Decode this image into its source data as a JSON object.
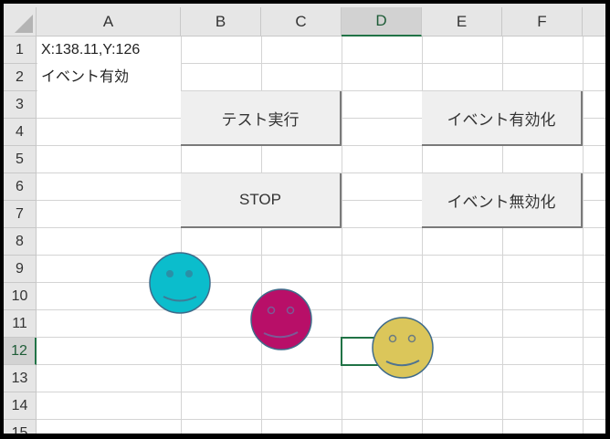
{
  "columns": [
    "A",
    "B",
    "C",
    "D",
    "E",
    "F"
  ],
  "rows": [
    "1",
    "2",
    "3",
    "4",
    "5",
    "6",
    "7",
    "8",
    "9",
    "10",
    "11",
    "12",
    "13",
    "14",
    "15"
  ],
  "selected_cell": "D12",
  "cells": {
    "A1": "X:138.11,Y:126",
    "A2": "イベント有効"
  },
  "buttons": {
    "test_run": "テスト実行",
    "stop": "STOP",
    "enable_events": "イベント有効化",
    "disable_events": "イベント無効化"
  },
  "shapes": [
    {
      "type": "smiley",
      "fill": "#0bbdcc"
    },
    {
      "type": "smiley",
      "fill": "#b80f68"
    },
    {
      "type": "smiley",
      "fill": "#dbc65a"
    }
  ],
  "colors": {
    "selection": "#217346",
    "shape_outline": "#3f6b8a"
  }
}
